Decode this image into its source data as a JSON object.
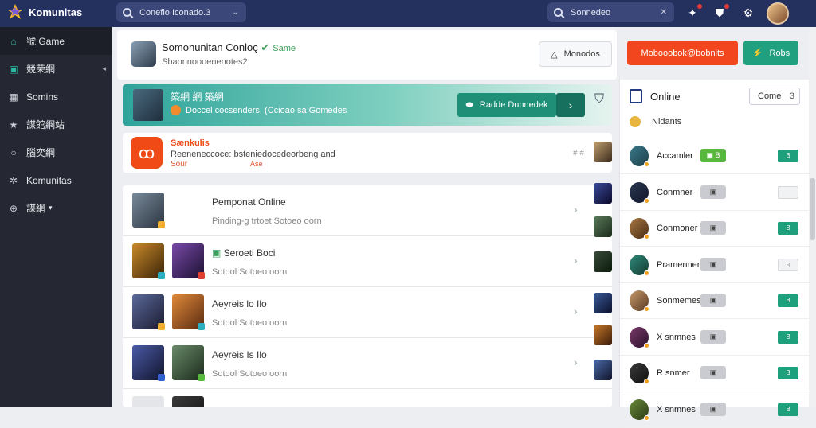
{
  "topbar": {
    "logo_text": "Komunitas",
    "search_left": "Conefio Iconado.3",
    "search_right": "Sonnedeo"
  },
  "sidebar": {
    "items": [
      {
        "label": "號 Game",
        "icon": "home-icon"
      },
      {
        "label": "競荣網",
        "icon": "bookmark-icon"
      },
      {
        "label": "Somins",
        "icon": "grid-icon"
      },
      {
        "label": "謀館網站",
        "icon": "star-icon"
      },
      {
        "label": "腦奕網",
        "icon": "search-icon"
      },
      {
        "label": "Komunitas",
        "icon": "sparkle-icon"
      },
      {
        "label": "謀網",
        "icon": "globe-icon"
      }
    ]
  },
  "profile": {
    "title": "Somonunitan Conloç",
    "status": "Same",
    "subtitle": "Sbaonnoooenenotes2",
    "button_outline": "Monodos",
    "button_red": "Mobooobok@bobnits",
    "button_green": "Robs"
  },
  "banner": {
    "title": "築網 網 築網",
    "subtitle": "Doccel cocsenders, (Ccioao sa Gomedes",
    "button": "Radde Dunnedek",
    "next": "›"
  },
  "notice": {
    "title": "Sænkulis",
    "text": "Reeneneccoce: bsteniedocedeorbeng and",
    "tag": "Sour",
    "tag2": "Ase",
    "mark": "# #"
  },
  "feed": [
    {
      "title": "Pemponat Online",
      "sub": "Pinding-g trtoet Sotoeo oorn"
    },
    {
      "title": "Seroeti Boci",
      "sub": "Sotool Sotoeo oorn"
    },
    {
      "title": "Aeyreis lo Ilo",
      "sub": "Sotool Sotoeo oorn"
    },
    {
      "title": "Aeyreis Is Ilo",
      "sub": "Sotool Sotoeo oorn"
    },
    {
      "title": "",
      "sub": ""
    }
  ],
  "right": {
    "title": "Online",
    "select": "Come",
    "select_caret": "3",
    "subtitle": "Nidants",
    "friends": [
      {
        "name": "Accamler",
        "tag": "B",
        "act": "B",
        "tag_green": true,
        "act_on": true,
        "colors": [
          "#3b7a8a",
          "#1c3f4a"
        ]
      },
      {
        "name": "Conmner",
        "tag": "",
        "act": "",
        "tag_green": false,
        "act_on": false,
        "colors": [
          "#2a3550",
          "#10182a"
        ]
      },
      {
        "name": "Conmoner",
        "tag": "",
        "act": "B",
        "tag_green": false,
        "act_on": true,
        "colors": [
          "#a87842",
          "#4a2c14"
        ]
      },
      {
        "name": "Pramenner",
        "tag": "",
        "act": "B",
        "tag_green": false,
        "act_on": false,
        "colors": [
          "#2f8a7a",
          "#163a33"
        ]
      },
      {
        "name": "Sonmemes",
        "tag": "",
        "act": "B",
        "tag_green": false,
        "act_on": true,
        "colors": [
          "#c69a6a",
          "#5a3a22"
        ]
      },
      {
        "name": "X snmnes",
        "tag": "",
        "act": "B",
        "tag_green": false,
        "act_on": true,
        "colors": [
          "#7a3a6a",
          "#2a102a"
        ]
      },
      {
        "name": "R snmer",
        "tag": "",
        "act": "B",
        "tag_green": false,
        "act_on": true,
        "colors": [
          "#3a3a3a",
          "#101010"
        ]
      },
      {
        "name": "X snmnes",
        "tag": "",
        "act": "B",
        "tag_green": false,
        "act_on": true,
        "colors": [
          "#6a8a3a",
          "#2a3a14"
        ]
      }
    ]
  },
  "colors": {
    "topbar": "#24305e",
    "sidebar": "#252832",
    "accent_green": "#21a07f",
    "accent_red": "#f2471e"
  }
}
